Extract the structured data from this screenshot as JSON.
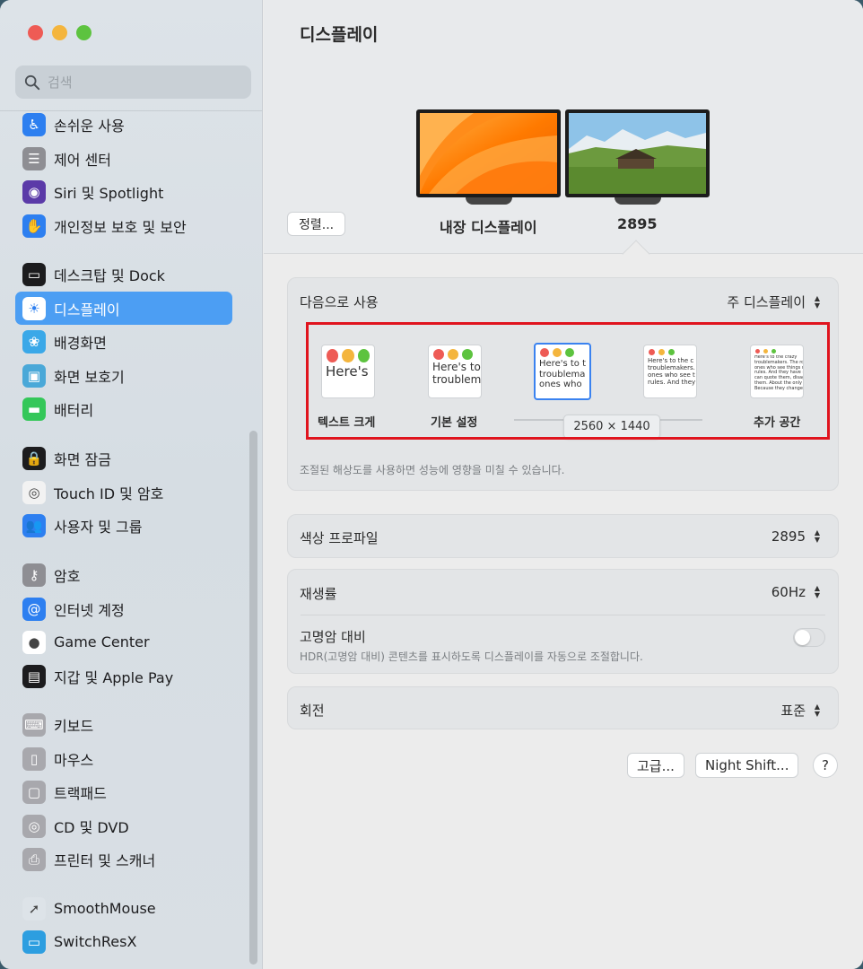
{
  "search": {
    "placeholder": "검색"
  },
  "sidebar": {
    "items": [
      {
        "label": "손쉬운 사용",
        "icon": "accessibility-icon",
        "color": "#2d7ff0",
        "glyph": "♿"
      },
      {
        "label": "제어 센터",
        "icon": "control-center-icon",
        "color": "#8e8e93",
        "glyph": "☰"
      },
      {
        "label": "Siri 및 Spotlight",
        "icon": "siri-icon",
        "color": "#5b3aa8",
        "glyph": "◉"
      },
      {
        "label": "개인정보 보호 및 보안",
        "icon": "privacy-hand-icon",
        "color": "#2d7ff0",
        "glyph": "✋"
      },
      {
        "label": "데스크탑 및 Dock",
        "icon": "desktop-dock-icon",
        "color": "#1c1c1e",
        "glyph": "▭"
      },
      {
        "label": "디스플레이",
        "icon": "display-sun-icon",
        "color": "#2d7ff0",
        "glyph": "☀"
      },
      {
        "label": "배경화면",
        "icon": "wallpaper-icon",
        "color": "#3aa8e8",
        "glyph": "❀"
      },
      {
        "label": "화면 보호기",
        "icon": "screensaver-icon",
        "color": "#4aa8d8",
        "glyph": "▣"
      },
      {
        "label": "배터리",
        "icon": "battery-icon",
        "color": "#34c759",
        "glyph": "▬"
      },
      {
        "label": "화면 잠금",
        "icon": "lock-icon",
        "color": "#1c1c1e",
        "glyph": "🔒"
      },
      {
        "label": "Touch ID 및 암호",
        "icon": "fingerprint-icon",
        "color": "#f2f2f2",
        "glyph": "◎"
      },
      {
        "label": "사용자 및 그룹",
        "icon": "users-icon",
        "color": "#2d7ff0",
        "glyph": "👥"
      },
      {
        "label": "암호",
        "icon": "key-icon",
        "color": "#8e8e93",
        "glyph": "⚷"
      },
      {
        "label": "인터넷 계정",
        "icon": "at-icon",
        "color": "#2d7ff0",
        "glyph": "@"
      },
      {
        "label": "Game Center",
        "icon": "game-center-icon",
        "color": "#ffffff",
        "glyph": "●"
      },
      {
        "label": "지갑 및 Apple Pay",
        "icon": "wallet-icon",
        "color": "#1c1c1e",
        "glyph": "▤"
      },
      {
        "label": "키보드",
        "icon": "keyboard-icon",
        "color": "#a8a8ad",
        "glyph": "⌨"
      },
      {
        "label": "마우스",
        "icon": "mouse-icon",
        "color": "#a8a8ad",
        "glyph": "▯"
      },
      {
        "label": "트랙패드",
        "icon": "trackpad-icon",
        "color": "#a8a8ad",
        "glyph": "▢"
      },
      {
        "label": "CD 및 DVD",
        "icon": "disc-icon",
        "color": "#a8a8ad",
        "glyph": "◎"
      },
      {
        "label": "프린터 및 스캐너",
        "icon": "printer-icon",
        "color": "#a8a8ad",
        "glyph": "⎙"
      },
      {
        "label": "SmoothMouse",
        "icon": "cursor-icon",
        "color": "#dde3e8",
        "glyph": "➚"
      },
      {
        "label": "SwitchResX",
        "icon": "monitor-icon",
        "color": "#2d9ee0",
        "glyph": "▭"
      }
    ]
  },
  "main": {
    "title": "디스플레이",
    "arrange_label": "정렬...",
    "displays": [
      {
        "label": "내장 디스플레이"
      },
      {
        "label": "2895"
      }
    ],
    "use_as": {
      "label": "다음으로 사용",
      "value": "주 디스플레이"
    },
    "resolutions": {
      "options": [
        {
          "caption": "텍스트 크게",
          "sample": "Here's"
        },
        {
          "caption": "기본 설정",
          "sample": "Here's to\ntroublem"
        },
        {
          "caption": "",
          "sample": "Here's to t\ntroublema\nones who"
        },
        {
          "caption": "",
          "sample": "Here's to the c\ntroublemakers.\nones who see t\nrules. And they"
        },
        {
          "caption": "추가 공간",
          "sample": "Here's to the crazy\ntroublemakers. The rou\nones who see things di\nrules. And they have n\ncan quote them, disagr\nthem. About the only th\nBecause they change t"
        }
      ],
      "tooltip": "2560 × 1440"
    },
    "hint": "조절된 해상도를 사용하면 성능에 영향을 미칠 수 있습니다.",
    "color_profile": {
      "label": "색상 프로파일",
      "value": "2895"
    },
    "refresh_rate": {
      "label": "재생률",
      "value": "60Hz"
    },
    "hdr": {
      "label": "고명암 대비",
      "desc": "HDR(고명암 대비) 콘텐츠를 표시하도록 디스플레이를 자동으로 조절합니다."
    },
    "rotation": {
      "label": "회전",
      "value": "표준"
    },
    "advanced_label": "고급...",
    "night_shift_label": "Night Shift...",
    "help_label": "?"
  }
}
